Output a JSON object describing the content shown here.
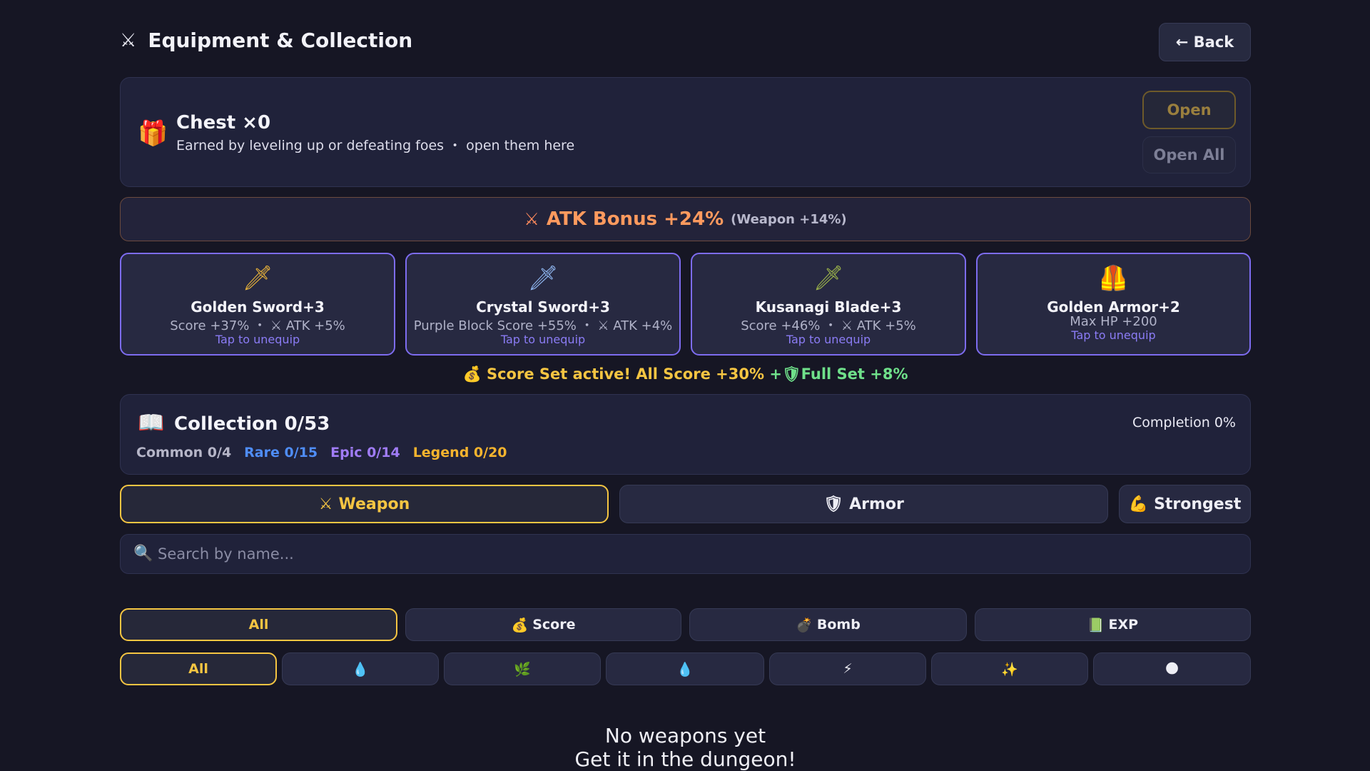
{
  "header": {
    "icon": "⚔",
    "title": "Equipment & Collection",
    "back_label": "← Back"
  },
  "chest": {
    "icon": "🎁",
    "title": "Chest ×0",
    "description": "Earned by leveling up or defeating foes ・ open them here",
    "open_label": "Open",
    "open_all_label": "Open All"
  },
  "atk_bonus": {
    "icon": "⚔",
    "main": "ATK Bonus +24%",
    "sub": "(Weapon +14%)"
  },
  "equipped": [
    {
      "icon": "🗡",
      "name": "Golden Sword+3",
      "stats": "Score +37% ・ ⚔ ATK +5%",
      "tap": "Tap to unequip"
    },
    {
      "icon": "🗡",
      "name": "Crystal Sword+3",
      "stats": "Purple Block Score +55% ・ ⚔ ATK +4%",
      "tap": "Tap to unequip"
    },
    {
      "icon": "🗡",
      "name": "Kusanagi Blade+3",
      "stats": "Score +46% ・ ⚔ ATK +5%",
      "tap": "Tap to unequip"
    },
    {
      "icon": "🦺",
      "name": "Golden Armor+2",
      "stats": "Max HP +200",
      "tap": "Tap to unequip"
    }
  ],
  "set_bonus": {
    "main": "💰 Score Set active! All Score +30%",
    "extra": "+🛡Full Set +8%"
  },
  "collection": {
    "icon": "📖",
    "title": "Collection 0/53",
    "completion": "Completion 0%",
    "common": "Common 0/4",
    "rare": "Rare 0/15",
    "epic": "Epic 0/14",
    "legend": "Legend 0/20"
  },
  "tabs": {
    "weapon": {
      "icon": "⚔",
      "label": "Weapon"
    },
    "armor": {
      "icon": "🛡",
      "label": "Armor"
    },
    "strongest": {
      "icon": "💪",
      "label": "Strongest"
    }
  },
  "search": {
    "placeholder": "Search by name...",
    "value": ""
  },
  "filters_type": [
    {
      "icon": "",
      "label": "All"
    },
    {
      "icon": "💰",
      "label": "Score"
    },
    {
      "icon": "💣",
      "label": "Bomb"
    },
    {
      "icon": "📗",
      "label": "EXP"
    }
  ],
  "filters_element": [
    {
      "label": "All"
    },
    {
      "label": "💧"
    },
    {
      "label": "🌿"
    },
    {
      "label": "💧"
    },
    {
      "label": "⚡"
    },
    {
      "label": "✨"
    },
    {
      "label": "🌑"
    }
  ],
  "empty": {
    "line1": "No weapons yet",
    "line2": "Get it in the dungeon!"
  },
  "colors": {
    "accent": "#f5c542",
    "equip_border": "#7d6cf0",
    "atk": "#ff9a5e",
    "rare": "#4f8df7",
    "epic": "#a07cf5",
    "legend": "#f5b42e"
  }
}
